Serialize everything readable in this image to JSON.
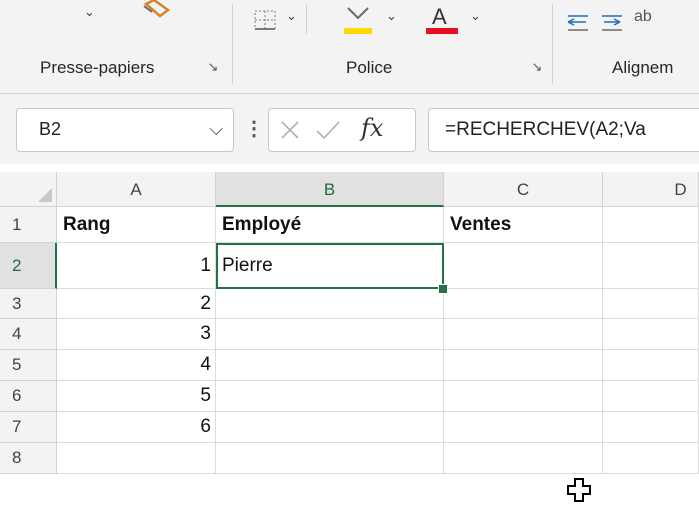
{
  "ribbon": {
    "groups": [
      {
        "label": "Presse-papiers"
      },
      {
        "label": "Police"
      },
      {
        "label": "Alignem"
      }
    ]
  },
  "formula_bar": {
    "name_box": "B2",
    "fx_label": "fx",
    "formula": "=RECHERCHEV(A2;Va"
  },
  "sheet": {
    "columns": [
      "A",
      "B",
      "C",
      "D"
    ],
    "rows": [
      "1",
      "2",
      "3",
      "4",
      "5",
      "6",
      "7",
      "8"
    ],
    "header_row": {
      "A": "Rang",
      "B": "Employé",
      "C": "Ventes"
    },
    "data": [
      {
        "A": "1",
        "B": "Pierre"
      },
      {
        "A": "2"
      },
      {
        "A": "3"
      },
      {
        "A": "4"
      },
      {
        "A": "5"
      },
      {
        "A": "6"
      }
    ],
    "active_cell": "B2"
  },
  "colors": {
    "accent": "#217346",
    "font_underline_red": "#e81123",
    "highlight_yellow": "#ffd800"
  }
}
